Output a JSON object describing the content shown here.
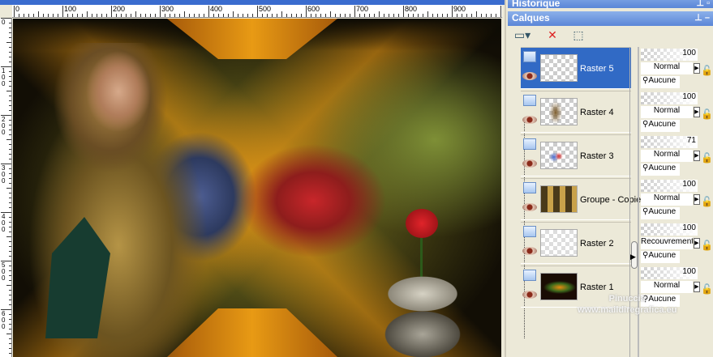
{
  "ruler": {
    "h_labels": [
      "0",
      "100",
      "200",
      "300",
      "400",
      "500",
      "600",
      "700",
      "800",
      "900"
    ],
    "v_labels": [
      "0",
      "100",
      "200",
      "300",
      "400",
      "500",
      "600"
    ]
  },
  "panels": {
    "history_title": "Historique",
    "layers_title": "Calques"
  },
  "toolbar": {
    "new_layer": "new-layer-icon",
    "delete_layer": "delete-layer-icon",
    "edit_selection": "edit-selection-icon"
  },
  "layers": [
    {
      "name": "Raster 5",
      "opacity": "100",
      "blend": "Normal",
      "mask": "Aucune",
      "selected": true
    },
    {
      "name": "Raster 4",
      "opacity": "100",
      "blend": "Normal",
      "mask": "Aucune"
    },
    {
      "name": "Raster 3",
      "opacity": "71",
      "blend": "Normal",
      "mask": "Aucune"
    },
    {
      "name": "Groupe - Copie",
      "opacity": "100",
      "blend": "Normal",
      "mask": "Aucune"
    },
    {
      "name": "Raster 2",
      "opacity": "100",
      "blend": "Recouvrement",
      "mask": "Aucune"
    },
    {
      "name": "Raster 1",
      "opacity": "100",
      "blend": "Normal",
      "mask": "Aucune"
    }
  ],
  "watermark": {
    "line1": "Pinuccia",
    "line2": "www.maildiregrafica.eu"
  },
  "colors": {
    "selection": "#316ac5",
    "title_bar": "#6b93dc"
  }
}
